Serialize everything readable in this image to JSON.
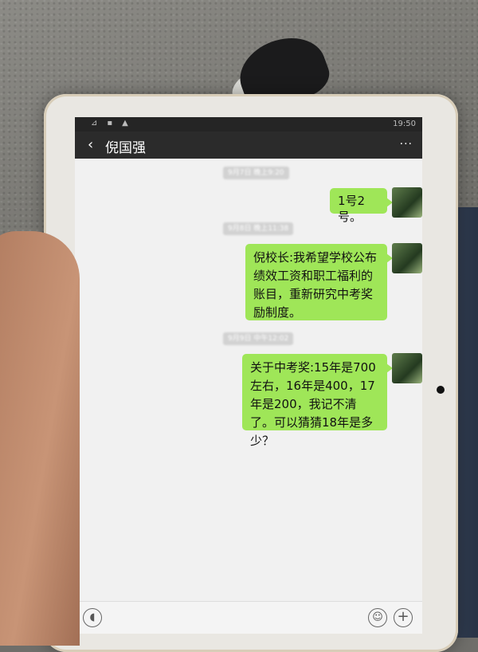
{
  "status_bar": {
    "left_icons": [
      "signal-icon",
      "lock-icon",
      "warning-icon"
    ],
    "time": "19:50"
  },
  "header": {
    "back_icon": "‹",
    "title": "倪国强",
    "more_icon": "···"
  },
  "messages": [
    {
      "timestamp": "9月7日 晚上9:20",
      "text": "1号2号。"
    },
    {
      "timestamp": "9月8日 晚上11:38",
      "text": "倪校长:我希望学校公布绩效工资和职工福利的账目，重新研究中考奖励制度。"
    },
    {
      "timestamp": "9月9日 中午12:02",
      "text": "关于中考奖:15年是700左右，16年是400，17年是200，我记不清了。可以猜猜18年是多少？"
    }
  ],
  "input_bar": {
    "voice_icon": "voice-icon",
    "emoji_icon": "emoji-icon",
    "add_icon": "plus-icon"
  },
  "colors": {
    "bubble": "#9fe658",
    "title_bar": "#2b2b2b",
    "screen_bg": "#f1f1f1"
  }
}
